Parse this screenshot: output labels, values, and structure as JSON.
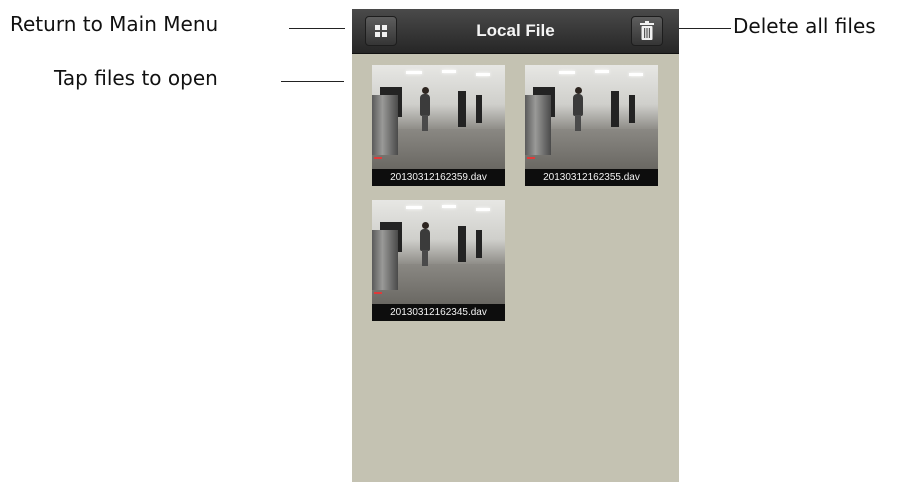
{
  "annotations": {
    "return_menu": "Return to Main Menu",
    "tap_files": "Tap files to open",
    "delete_all": "Delete all files"
  },
  "navbar": {
    "title": "Local File",
    "left_icon": "grid-icon",
    "right_icon": "trash-icon"
  },
  "files": [
    {
      "name": "20130312162359.dav"
    },
    {
      "name": "20130312162355.dav"
    },
    {
      "name": "20130312162345.dav"
    }
  ],
  "colors": {
    "screen_background": "#c4c2b2",
    "navbar": "#333333",
    "label_background": "#0d0d0d"
  }
}
